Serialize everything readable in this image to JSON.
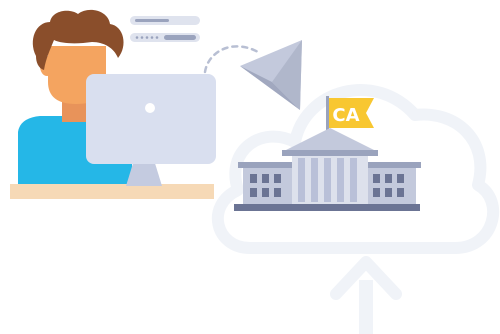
{
  "flag": {
    "text": "CA"
  },
  "colors": {
    "hair": "#8a4e2b",
    "skin": "#f4a460",
    "shirt": "#25b7e7",
    "monitor": "#d9dfef",
    "monitor_stand": "#c4cbe0",
    "desk": "#f6d9b6",
    "building": "#b9c0d8",
    "building_dark": "#6b7494",
    "flag": "#f8c731",
    "plane": "#c3c9dc",
    "cloud_outline": "#f0f3f8"
  },
  "icons": [
    "person-at-computer-icon",
    "paper-plane-icon",
    "government-building-icon",
    "flag-icon",
    "cloud-outline-icon",
    "upload-arrow-icon"
  ]
}
